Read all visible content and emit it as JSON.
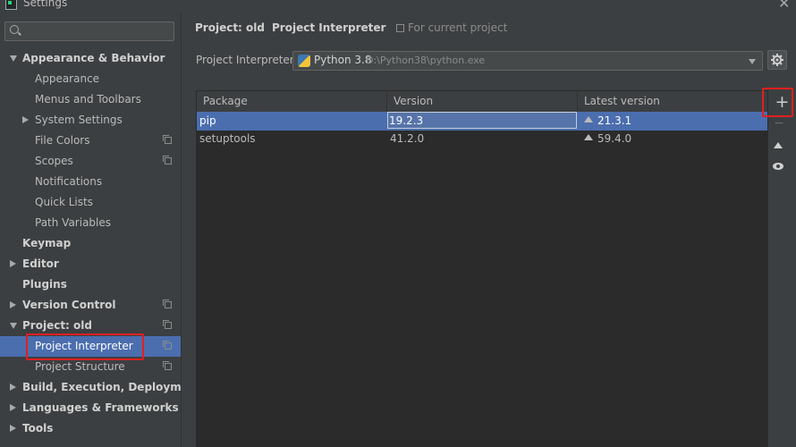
{
  "window": {
    "title": "Settings"
  },
  "search": {
    "placeholder": "",
    "value": ""
  },
  "sidebar": {
    "items": [
      {
        "label": "Appearance & Behavior",
        "bold": true,
        "arrow": "down",
        "indent": 0,
        "copy": false
      },
      {
        "label": "Appearance",
        "bold": false,
        "arrow": "",
        "indent": 1,
        "copy": false
      },
      {
        "label": "Menus and Toolbars",
        "bold": false,
        "arrow": "",
        "indent": 1,
        "copy": false
      },
      {
        "label": "System Settings",
        "bold": false,
        "arrow": "right",
        "indent": 1,
        "copy": false
      },
      {
        "label": "File Colors",
        "bold": false,
        "arrow": "",
        "indent": 1,
        "copy": true
      },
      {
        "label": "Scopes",
        "bold": false,
        "arrow": "",
        "indent": 1,
        "copy": true
      },
      {
        "label": "Notifications",
        "bold": false,
        "arrow": "",
        "indent": 1,
        "copy": false
      },
      {
        "label": "Quick Lists",
        "bold": false,
        "arrow": "",
        "indent": 1,
        "copy": false
      },
      {
        "label": "Path Variables",
        "bold": false,
        "arrow": "",
        "indent": 1,
        "copy": false
      },
      {
        "label": "Keymap",
        "bold": true,
        "arrow": "",
        "indent": 0,
        "copy": false
      },
      {
        "label": "Editor",
        "bold": true,
        "arrow": "right",
        "indent": 0,
        "copy": false
      },
      {
        "label": "Plugins",
        "bold": true,
        "arrow": "",
        "indent": 0,
        "copy": false
      },
      {
        "label": "Version Control",
        "bold": true,
        "arrow": "right",
        "indent": 0,
        "copy": true
      },
      {
        "label": "Project: old",
        "bold": true,
        "arrow": "down",
        "indent": 0,
        "copy": true
      },
      {
        "label": "Project Interpreter",
        "bold": false,
        "arrow": "",
        "indent": 1,
        "copy": true,
        "selected": true
      },
      {
        "label": "Project Structure",
        "bold": false,
        "arrow": "",
        "indent": 1,
        "copy": true
      },
      {
        "label": "Build, Execution, Deployment",
        "bold": true,
        "arrow": "right",
        "indent": 0,
        "copy": false
      },
      {
        "label": "Languages & Frameworks",
        "bold": true,
        "arrow": "right",
        "indent": 0,
        "copy": false
      },
      {
        "label": "Tools",
        "bold": true,
        "arrow": "right",
        "indent": 0,
        "copy": false
      }
    ]
  },
  "breadcrumb": {
    "project": "Project: old",
    "separator": "›",
    "page": "Project Interpreter",
    "scope": "For current project"
  },
  "interpreter": {
    "label": "Project Interpreter:",
    "name": "Python 3.8",
    "path": "D:\\Python38\\python.exe"
  },
  "table": {
    "columns": [
      "Package",
      "Version",
      "Latest version"
    ],
    "rows": [
      {
        "package": "pip",
        "version": "19.2.3",
        "latest": "21.3.1",
        "upgrade": true,
        "selected": true
      },
      {
        "package": "setuptools",
        "version": "41.2.0",
        "latest": "59.4.0",
        "upgrade": true,
        "selected": false
      }
    ]
  },
  "toolbar": {
    "add": "+",
    "remove": "−"
  },
  "colors": {
    "background": "#3c3f41",
    "selection": "#4b6eaf",
    "highlight": "#e02020",
    "table_bg": "#2b2b2b"
  }
}
